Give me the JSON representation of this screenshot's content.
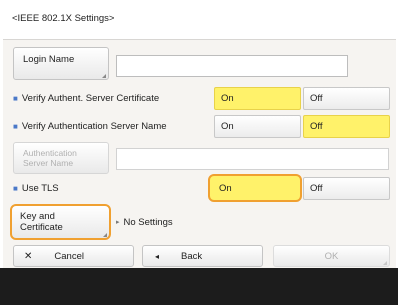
{
  "screen": {
    "title": "<IEEE 802.1X Settings>"
  },
  "form": {
    "login_name_label": "Login Name",
    "login_name_value": "",
    "verify_server_cert": {
      "label": "Verify Authent. Server Certificate",
      "on": "On",
      "off": "Off",
      "selected": "On"
    },
    "verify_server_name": {
      "label": "Verify Authentication Server Name",
      "on": "On",
      "off": "Off",
      "selected": "Off"
    },
    "auth_server_name_label_line1": "Authentication",
    "auth_server_name_label_line2": "Server Name",
    "auth_server_name_value": "",
    "use_tls": {
      "label": "Use TLS",
      "on": "On",
      "off": "Off",
      "selected": "On"
    },
    "key_cert_label_line1": "Key and",
    "key_cert_label_line2": "Certificate",
    "key_cert_status": "No Settings"
  },
  "footer": {
    "cancel": "Cancel",
    "back": "Back",
    "ok": "OK"
  },
  "icons": {
    "cancel": "close-icon",
    "back": "back-arrow-icon"
  }
}
